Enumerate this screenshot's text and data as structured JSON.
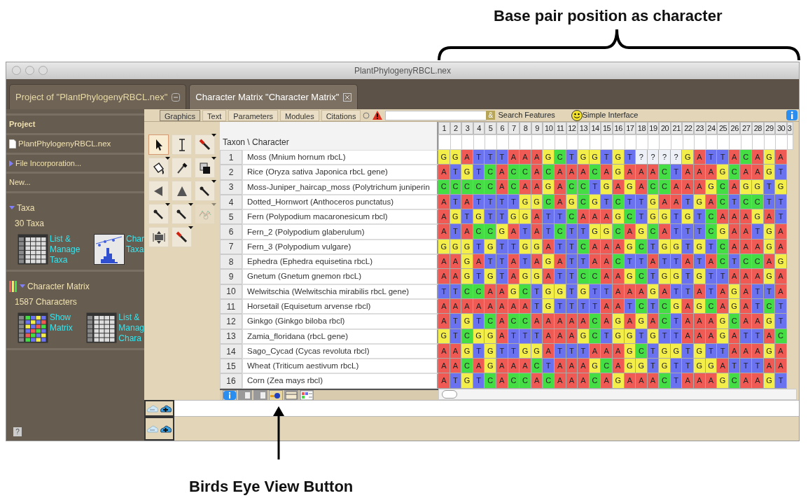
{
  "top_annotation": {
    "text": "Base pair position as character"
  },
  "bottom_annotation": {
    "text": "Birds Eye View Button"
  },
  "window": {
    "title": "PlantPhylogenyRBCL.nex"
  },
  "tabs": [
    {
      "label": "Project of \"PlantPhylogenyRBCL.nex\"",
      "selected": false
    },
    {
      "label": "Character Matrix \"Character Matrix\"",
      "selected": true
    }
  ],
  "project_panel": {
    "heading": "Project",
    "file": "PlantPhylogenyRBCL.nex",
    "items": [
      {
        "label": "File Incorporation...",
        "expanded": false
      },
      {
        "label": "New..."
      }
    ],
    "sections": [
      {
        "kind": "taxa",
        "title": "Taxa",
        "expanded": true,
        "count": "30 Taxa",
        "links": [
          {
            "kind": "list",
            "lines": [
              "List &",
              "Manage",
              "Taxa"
            ]
          },
          {
            "kind": "chart",
            "lines": [
              "Char",
              "Taxa"
            ]
          }
        ]
      },
      {
        "kind": "matrix",
        "title": "Character Matrix",
        "expanded": true,
        "count": "1587 Characters",
        "links": [
          {
            "kind": "matrix",
            "lines": [
              "Show",
              "Matrix"
            ]
          },
          {
            "kind": "list",
            "lines": [
              "List &",
              "Manag",
              "Chara"
            ]
          }
        ]
      }
    ],
    "help_glyph": "?"
  },
  "toolbar": {
    "tabs": [
      {
        "label": "Graphics",
        "selected": true
      },
      {
        "label": "Text",
        "selected": false
      },
      {
        "label": "Parameters",
        "selected": false
      },
      {
        "label": "Modules",
        "selected": false
      },
      {
        "label": "Citations",
        "selected": false
      }
    ],
    "features_glyph": "&",
    "search_features": "Search Features",
    "simple_interface": "Simple Interface"
  },
  "tools": [
    {
      "kind": "pointer",
      "selected": true,
      "menu": false,
      "disabled": false
    },
    {
      "kind": "ibeam",
      "selected": false,
      "menu": false,
      "disabled": false
    },
    {
      "kind": "brush",
      "selected": false,
      "menu": true,
      "disabled": false
    },
    {
      "kind": "bucket",
      "selected": false,
      "menu": true,
      "disabled": false
    },
    {
      "kind": "dropper",
      "selected": false,
      "menu": false,
      "disabled": false
    },
    {
      "kind": "stamp",
      "selected": false,
      "menu": true,
      "disabled": false
    },
    {
      "kind": "left",
      "selected": false,
      "menu": false,
      "disabled": false
    },
    {
      "kind": "up",
      "selected": false,
      "menu": false,
      "disabled": false
    },
    {
      "kind": "wand",
      "selected": false,
      "menu": true,
      "disabled": false
    },
    {
      "kind": "wand",
      "selected": false,
      "menu": true,
      "disabled": false
    },
    {
      "kind": "wand",
      "selected": false,
      "menu": true,
      "disabled": false
    },
    {
      "kind": "graph",
      "selected": false,
      "menu": true,
      "disabled": true
    },
    {
      "kind": "expand",
      "selected": false,
      "menu": false,
      "disabled": false
    },
    {
      "kind": "brush",
      "selected": false,
      "menu": true,
      "disabled": false
    }
  ],
  "matrix": {
    "corner": "Taxon \\ Character",
    "columns": [
      "1",
      "2",
      "3",
      "4",
      "5",
      "6",
      "7",
      "8",
      "9",
      "10",
      "11",
      "12",
      "13",
      "14",
      "15",
      "16",
      "17",
      "18",
      "19",
      "20",
      "21",
      "22",
      "23",
      "24",
      "25",
      "26",
      "27",
      "28",
      "29",
      "30",
      "3"
    ],
    "rows": [
      {
        "number": "1",
        "taxon": "Moss (Mnium hornum rbcL)",
        "states": "G G A T T T A A A G C T G G T G T ? ? ? ? G A T T A C A G A"
      },
      {
        "number": "2",
        "taxon": "Rice (Oryza sativa Japonica rbcL gene)",
        "states": "A T G T C A C C A C A A A C A G A A A C T A A A G C A A G T"
      },
      {
        "number": "3",
        "taxon": "Moss-Juniper_haircap_moss (Polytrichum juniperin",
        "states": "C C C C C A C A A G A C C T G A G A C C A A A G C A G G T G"
      },
      {
        "number": "4",
        "taxon": "Dotted_Hornwort (Anthoceros punctatus)",
        "states": "A T A T T T T G G C A G C G T C T T G A A T G A C T C C T T"
      },
      {
        "number": "5",
        "taxon": "Fern (Polypodium macaronesicum rbcl)",
        "states": "A G T G T T G G A T T C A A A G C T G G T G T C A A A G A T"
      },
      {
        "number": "6",
        "taxon": "Fern_2 (Polypodium glaberulum)",
        "states": "A T A C C G A T A T C T T G G C A G C A T T T C G A A T G A"
      },
      {
        "number": "7",
        "taxon": "Fern_3 (Polypodium vulgare)",
        "states": "G G G T G T T G G A T T C A A A G C T G G T G T C A A A G A"
      },
      {
        "number": "8",
        "taxon": "Ephedra (Ephedra equisetina rbcL)",
        "states": "A A G A T T A T A G A T T A A C T T A T T A T A C T C C A G"
      },
      {
        "number": "9",
        "taxon": "Gnetum (Gnetum gnemon rbcL)",
        "states": "A A G T G T A G G A T T C C A A G C T G G T G T T A A A G A"
      },
      {
        "number": "10",
        "taxon": "Welwitschia (Welwitschia mirabilis rbcL gene)",
        "states": "T T C C A A G C T G G T G T T A A A G A T T A T A G A T T A"
      },
      {
        "number": "11",
        "taxon": "Horsetail (Equisetum arvense rbcl)",
        "states": "A A A A A A A A T G T T T T A A T C T C G A G C A G A T C T"
      },
      {
        "number": "12",
        "taxon": "Ginkgo (Ginkgo biloba rbcl)",
        "states": "A T G T C A C C A A A A A C A G A G A C T A A A G C A A G T"
      },
      {
        "number": "13",
        "taxon": "Zamia_floridana (rbcL gene)",
        "states": "G T C G G A T T T A A A G C T G G T G T T A A A G A T T A C"
      },
      {
        "number": "14",
        "taxon": "Sago_Cycad (Cycas revoluta rbcl)",
        "states": "A A G T G T T G G A T T T A A A G C T G G T G T T A A A G A"
      },
      {
        "number": "15",
        "taxon": "Wheat (Triticum aestivum rbcL)",
        "states": "A A C A G A A A C T A A A G C A G G T G T T G G A T T T A A"
      },
      {
        "number": "16",
        "taxon": "Corn (Zea mays rbcl)",
        "states": "A T G T C A C C A C A A A C A G A A A C T A A A G C A A G T"
      }
    ]
  }
}
